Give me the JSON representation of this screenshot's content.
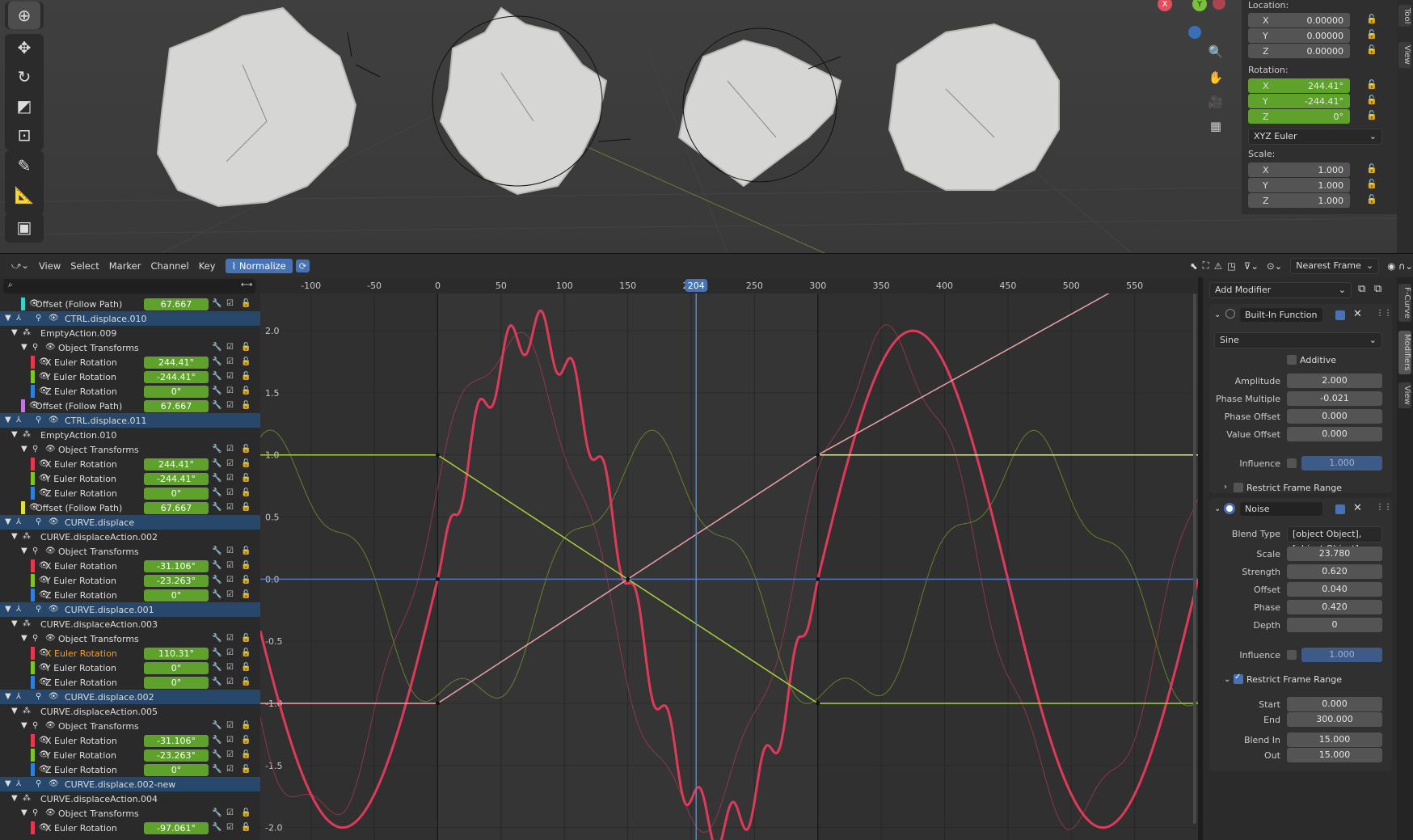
{
  "viewport": {
    "gizmo": {
      "x": "X",
      "y": "Y"
    },
    "transform": {
      "location_label": "Location:",
      "location": [
        {
          "axis": "X",
          "value": "0.00000"
        },
        {
          "axis": "Y",
          "value": "0.00000"
        },
        {
          "axis": "Z",
          "value": "0.00000"
        }
      ],
      "rotation_label": "Rotation:",
      "rotation": [
        {
          "axis": "X",
          "value": "244.41°"
        },
        {
          "axis": "Y",
          "value": "-244.41°"
        },
        {
          "axis": "Z",
          "value": "0°"
        }
      ],
      "rotation_mode": "XYZ Euler",
      "scale_label": "Scale:",
      "scale": [
        {
          "axis": "X",
          "value": "1.000"
        },
        {
          "axis": "Y",
          "value": "1.000"
        },
        {
          "axis": "Z",
          "value": "1.000"
        }
      ]
    },
    "side_tabs": [
      "Tool",
      "View"
    ]
  },
  "graph_header": {
    "menus": [
      "View",
      "Select",
      "Marker",
      "Channel",
      "Key"
    ],
    "normalize": "Normalize",
    "snap": "Nearest Frame"
  },
  "channels": [
    {
      "type": "ch",
      "name": "Offset (Follow Path)",
      "value": "67.667",
      "color": "#3cd1c8",
      "indent": 40
    },
    {
      "type": "obj",
      "name": "CTRL.displace.010"
    },
    {
      "type": "act",
      "name": "EmptyAction.009"
    },
    {
      "type": "grp",
      "name": "Object Transforms"
    },
    {
      "type": "ch",
      "name": "X Euler Rotation",
      "value": "244.41°",
      "color": "#e8384f",
      "indent": 52
    },
    {
      "type": "ch",
      "name": "Y Euler Rotation",
      "value": "-244.41°",
      "color": "#7ec626",
      "indent": 52
    },
    {
      "type": "ch",
      "name": "Z Euler Rotation",
      "value": "0°",
      "color": "#2e7fe0",
      "indent": 52
    },
    {
      "type": "ch",
      "name": "Offset (Follow Path)",
      "value": "67.667",
      "color": "#c078e0",
      "indent": 40
    },
    {
      "type": "obj",
      "name": "CTRL.displace.011"
    },
    {
      "type": "act",
      "name": "EmptyAction.010"
    },
    {
      "type": "grp",
      "name": "Object Transforms"
    },
    {
      "type": "ch",
      "name": "X Euler Rotation",
      "value": "244.41°",
      "color": "#e8384f",
      "indent": 52
    },
    {
      "type": "ch",
      "name": "Y Euler Rotation",
      "value": "-244.41°",
      "color": "#7ec626",
      "indent": 52
    },
    {
      "type": "ch",
      "name": "Z Euler Rotation",
      "value": "0°",
      "color": "#2e7fe0",
      "indent": 52
    },
    {
      "type": "ch",
      "name": "Offset (Follow Path)",
      "value": "67.667",
      "color": "#e0e038",
      "indent": 40
    },
    {
      "type": "obj",
      "name": "CURVE.displace"
    },
    {
      "type": "act",
      "name": "CURVE.displaceAction.002"
    },
    {
      "type": "grp",
      "name": "Object Transforms"
    },
    {
      "type": "ch",
      "name": "X Euler Rotation",
      "value": "-31.106°",
      "color": "#e8384f",
      "indent": 52
    },
    {
      "type": "ch",
      "name": "Y Euler Rotation",
      "value": "-23.263°",
      "color": "#7ec626",
      "indent": 52
    },
    {
      "type": "ch",
      "name": "Z Euler Rotation",
      "value": "0°",
      "color": "#2e7fe0",
      "indent": 52
    },
    {
      "type": "obj",
      "name": "CURVE.displace.001"
    },
    {
      "type": "act",
      "name": "CURVE.displaceAction.003"
    },
    {
      "type": "grp",
      "name": "Object Transforms"
    },
    {
      "type": "ch",
      "name": "X Euler Rotation",
      "value": "110.31°",
      "color": "#e8384f",
      "indent": 52,
      "active": true
    },
    {
      "type": "ch",
      "name": "Y Euler Rotation",
      "value": "0°",
      "color": "#7ec626",
      "indent": 52
    },
    {
      "type": "ch",
      "name": "Z Euler Rotation",
      "value": "0°",
      "color": "#2e7fe0",
      "indent": 52
    },
    {
      "type": "obj",
      "name": "CURVE.displace.002"
    },
    {
      "type": "act",
      "name": "CURVE.displaceAction.005"
    },
    {
      "type": "grp",
      "name": "Object Transforms"
    },
    {
      "type": "ch",
      "name": "X Euler Rotation",
      "value": "-31.106°",
      "color": "#e8384f",
      "indent": 52
    },
    {
      "type": "ch",
      "name": "Y Euler Rotation",
      "value": "-23.263°",
      "color": "#7ec626",
      "indent": 52
    },
    {
      "type": "ch",
      "name": "Z Euler Rotation",
      "value": "0°",
      "color": "#2e7fe0",
      "indent": 52
    },
    {
      "type": "obj",
      "name": "CURVE.displace.002-new"
    },
    {
      "type": "act",
      "name": "CURVE.displaceAction.004"
    },
    {
      "type": "grp",
      "name": "Object Transforms"
    },
    {
      "type": "ch",
      "name": "X Euler Rotation",
      "value": "-97.061°",
      "color": "#e8384f",
      "indent": 52
    }
  ],
  "graph": {
    "current_frame": "204",
    "frame_ticks": [
      -100,
      -50,
      0,
      50,
      100,
      150,
      200,
      250,
      300,
      350,
      400,
      450,
      500,
      550
    ],
    "value_ticks": [
      2.0,
      1.5,
      1.0,
      0.5,
      0.0,
      -0.5,
      -1.0,
      -1.5,
      -2.0
    ]
  },
  "chart_data": {
    "type": "line",
    "xlabel": "",
    "ylabel": "",
    "xlim": [
      -140,
      600
    ],
    "ylim": [
      -2.1,
      2.3
    ],
    "series": [
      {
        "function": "sine",
        "amplitude": 2.0,
        "period": 300,
        "color": "#e03a5a",
        "emphasis": "active"
      },
      {
        "function": "linear",
        "from": [
          0,
          -1.0
        ],
        "to": [
          300,
          1.0
        ],
        "color": "#f0a0a8"
      },
      {
        "function": "linear",
        "from": [
          0,
          1.0
        ],
        "to": [
          300,
          -1.0
        ],
        "color": "#a8d23a"
      },
      {
        "function": "constant",
        "value": 0.0,
        "color": "#4a78c8"
      }
    ]
  },
  "modifiers": {
    "add_modifier": "Add Modifier",
    "builtin": {
      "title": "Built-In Function",
      "function": "Sine",
      "additive": "Additive",
      "fields": [
        {
          "label": "Amplitude",
          "value": "2.000"
        },
        {
          "label": "Phase Multiple",
          "value": "-0.021"
        },
        {
          "label": "Phase Offset",
          "value": "0.000"
        },
        {
          "label": "Value Offset",
          "value": "0.000"
        }
      ],
      "influence_label": "Influence",
      "influence": "1.000",
      "restrict": "Restrict Frame Range"
    },
    "noise": {
      "title": "Noise",
      "blend_label": "Blend Type",
      "blend": [
        {
          "label": "Blend In",
          "value": "15.000"
        },
        {
          "label": "Out",
          "value": "15.000"
        }
      ],
      "fields": [
        {
          "label": "Scale",
          "value": "23.780"
        },
        {
          "label": "Strength",
          "value": "0.620"
        },
        {
          "label": "Offset",
          "value": "0.040"
        },
        {
          "label": "Phase",
          "value": "0.420"
        },
        {
          "label": "Depth",
          "value": "0"
        }
      ],
      "influence_label": "Influence",
      "influence": "1.000",
      "restrict": "Restrict Frame Range",
      "range": [
        {
          "label": "Start",
          "value": "0.000"
        },
        {
          "label": "End",
          "value": "300.000"
        }
      ]
    },
    "tabs": [
      "F-Curve",
      "Modifiers",
      "View"
    ]
  }
}
